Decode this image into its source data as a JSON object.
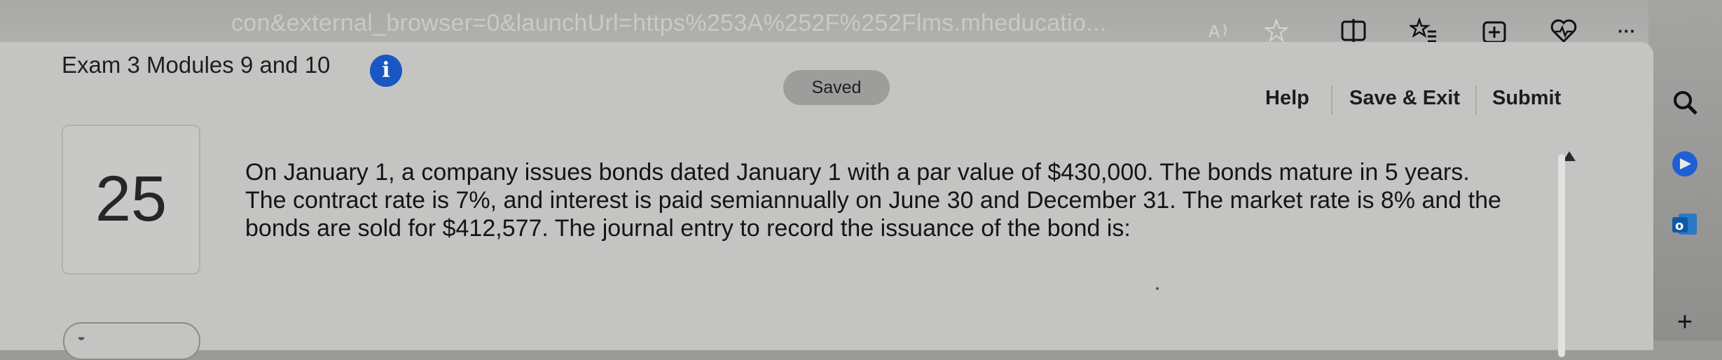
{
  "browser": {
    "url_fragment": "con&external_browser=0&launchUrl=https%253A%252F%252Flms.mheducatio...",
    "toolbar_icons": [
      "read-aloud-icon",
      "favorite-star-icon",
      "split-screen-icon",
      "favorites-list-icon",
      "collections-icon",
      "performance-heart-icon",
      "more-dots-icon",
      "copilot-icon"
    ],
    "more_label": "···"
  },
  "sidebar": {
    "icons": [
      "search-icon",
      "copilot-discover-icon",
      "outlook-icon",
      "add-icon"
    ],
    "add_label": "+"
  },
  "header": {
    "title": "Exam 3 Modules 9 and 10",
    "info_label": "i",
    "status_badge": "Saved",
    "help_label": "Help",
    "save_exit_label": "Save & Exit",
    "submit_label": "Submit"
  },
  "question": {
    "number": "25",
    "text": "On January 1, a company issues bonds dated January 1 with a par value of $430,000. The bonds mature in 5 years. The contract rate is 7%, and interest is paid semiannually on June 30 and December 31. The market rate is 8% and the bonds are sold for $412,577. The journal entry to record the issuance of the bond is:"
  },
  "colors": {
    "info_blue": "#1a56c4",
    "page_bg": "#c4c4c2"
  }
}
